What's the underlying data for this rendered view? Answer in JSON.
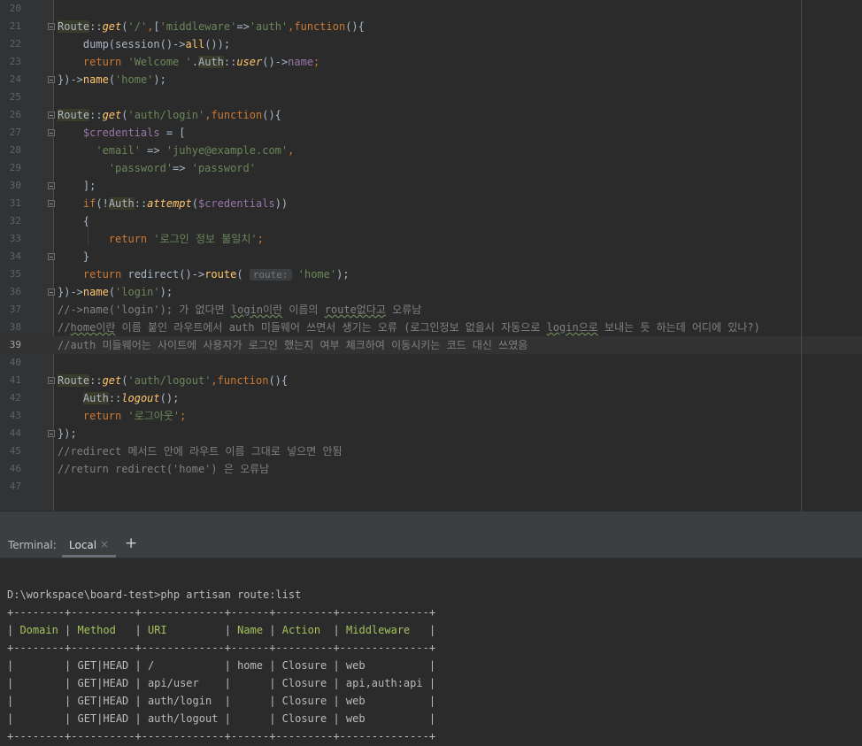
{
  "editor": {
    "current_line": "39",
    "lines": [
      {
        "num": "20",
        "parts": []
      },
      {
        "num": "21",
        "fold": true,
        "parts": [
          [
            "cls",
            "Route"
          ],
          [
            "p",
            "::"
          ],
          [
            "fn it",
            "get"
          ],
          [
            "p",
            "("
          ],
          [
            "str",
            "'/'"
          ],
          [
            "kw",
            ","
          ],
          [
            "p",
            "["
          ],
          [
            "str",
            "'middleware'"
          ],
          [
            "p",
            "=>"
          ],
          [
            "str",
            "'auth'"
          ],
          [
            "kw",
            ","
          ],
          [
            "kw",
            "function"
          ],
          [
            "p",
            "(){"
          ]
        ]
      },
      {
        "num": "22",
        "parts": [
          [
            "p",
            "    dump(session()->"
          ],
          [
            "fn",
            "all"
          ],
          [
            "p",
            "());"
          ]
        ]
      },
      {
        "num": "23",
        "parts": [
          [
            "p",
            "    "
          ],
          [
            "kw",
            "return "
          ],
          [
            "str",
            "'Welcome '"
          ],
          [
            "p",
            "."
          ],
          [
            "cls",
            "Auth"
          ],
          [
            "p",
            "::"
          ],
          [
            "fn it",
            "user"
          ],
          [
            "p",
            "()->"
          ],
          [
            "var",
            "name"
          ],
          [
            "kw",
            ";"
          ]
        ]
      },
      {
        "num": "24",
        "fold": true,
        "parts": [
          [
            "p",
            "})->"
          ],
          [
            "fn",
            "name"
          ],
          [
            "p",
            "("
          ],
          [
            "str",
            "'home'"
          ],
          [
            "p",
            ");"
          ]
        ]
      },
      {
        "num": "25",
        "parts": []
      },
      {
        "num": "26",
        "fold": true,
        "parts": [
          [
            "cls",
            "Route"
          ],
          [
            "p",
            "::"
          ],
          [
            "fn it",
            "get"
          ],
          [
            "p",
            "("
          ],
          [
            "str",
            "'auth/login'"
          ],
          [
            "kw",
            ","
          ],
          [
            "kw",
            "function"
          ],
          [
            "p",
            "(){"
          ]
        ]
      },
      {
        "num": "27",
        "fold": true,
        "parts": [
          [
            "p",
            "    "
          ],
          [
            "var",
            "$credentials"
          ],
          [
            "p",
            " = ["
          ]
        ]
      },
      {
        "num": "28",
        "parts": [
          [
            "p",
            "      "
          ],
          [
            "str",
            "'email'"
          ],
          [
            "p",
            " => "
          ],
          [
            "str",
            "'juhye@example.com'"
          ],
          [
            "kw",
            ","
          ]
        ]
      },
      {
        "num": "29",
        "parts": [
          [
            "p",
            "        "
          ],
          [
            "str",
            "'password'"
          ],
          [
            "p",
            "=> "
          ],
          [
            "str",
            "'password'"
          ]
        ]
      },
      {
        "num": "30",
        "fold": true,
        "parts": [
          [
            "p",
            "    ];"
          ]
        ]
      },
      {
        "num": "31",
        "fold": true,
        "parts": [
          [
            "p",
            "    "
          ],
          [
            "kw",
            "if"
          ],
          [
            "p",
            "(!"
          ],
          [
            "cls",
            "Auth"
          ],
          [
            "p",
            "::"
          ],
          [
            "fn it",
            "attempt"
          ],
          [
            "p",
            "("
          ],
          [
            "var",
            "$credentials"
          ],
          [
            "p",
            "))"
          ]
        ]
      },
      {
        "num": "32",
        "parts": [
          [
            "p",
            "    {"
          ]
        ]
      },
      {
        "num": "33",
        "parts": [
          [
            "p",
            "        "
          ],
          [
            "kw",
            "return "
          ],
          [
            "str",
            "'로그인 정보 불일치'"
          ],
          [
            "kw",
            ";"
          ]
        ]
      },
      {
        "num": "34",
        "fold": true,
        "parts": [
          [
            "p",
            "    }"
          ]
        ]
      },
      {
        "num": "35",
        "parts": [
          [
            "p",
            "    "
          ],
          [
            "kw",
            "return "
          ],
          [
            "p",
            "redirect()->"
          ],
          [
            "fn",
            "route"
          ],
          [
            "p",
            "( "
          ],
          [
            "hint",
            "route:"
          ],
          [
            "p",
            " "
          ],
          [
            "str",
            "'home'"
          ],
          [
            "p",
            ");"
          ]
        ]
      },
      {
        "num": "36",
        "fold": true,
        "parts": [
          [
            "p",
            "})->"
          ],
          [
            "fn",
            "name"
          ],
          [
            "p",
            "("
          ],
          [
            "str",
            "'login'"
          ],
          [
            "p",
            ");"
          ]
        ]
      },
      {
        "num": "37",
        "parts": [
          [
            "cm",
            "//->name('login'); 가 없다면 "
          ],
          [
            "cm sq",
            "login이란"
          ],
          [
            "cm",
            " 이름의 "
          ],
          [
            "cm sq",
            "route없다고"
          ],
          [
            "cm",
            " 오류남"
          ]
        ]
      },
      {
        "num": "38",
        "parts": [
          [
            "cm",
            "//"
          ],
          [
            "cm sq",
            "home이란"
          ],
          [
            "cm",
            " 이름 붙인 라우트에서 auth 미들웨어 쓰면서 생기는 오류 (로그인정보 없을시 자동으로 "
          ],
          [
            "cm sq",
            "login으로"
          ],
          [
            "cm",
            " 보내는 듯 하는데 어디에 있나?)"
          ]
        ]
      },
      {
        "num": "39",
        "parts": [
          [
            "cm",
            "//auth 미들웨어는 사이트에 사용자가 로그인 했는지 여부 체크하여 이동시키는 코드 대신 쓰였음"
          ]
        ]
      },
      {
        "num": "40",
        "parts": []
      },
      {
        "num": "41",
        "fold": true,
        "parts": [
          [
            "cls",
            "Route"
          ],
          [
            "p",
            "::"
          ],
          [
            "fn it",
            "get"
          ],
          [
            "p",
            "("
          ],
          [
            "str",
            "'auth/logout'"
          ],
          [
            "kw",
            ","
          ],
          [
            "kw",
            "function"
          ],
          [
            "p",
            "(){"
          ]
        ]
      },
      {
        "num": "42",
        "parts": [
          [
            "p",
            "    "
          ],
          [
            "cls",
            "Auth"
          ],
          [
            "p",
            "::"
          ],
          [
            "fn it",
            "logout"
          ],
          [
            "p",
            "();"
          ]
        ]
      },
      {
        "num": "43",
        "parts": [
          [
            "p",
            "    "
          ],
          [
            "kw",
            "return "
          ],
          [
            "str",
            "'로그아웃'"
          ],
          [
            "kw",
            ";"
          ]
        ]
      },
      {
        "num": "44",
        "fold": true,
        "parts": [
          [
            "p",
            "});"
          ]
        ]
      },
      {
        "num": "45",
        "parts": [
          [
            "cm",
            "//redirect 메서드 안에 라우트 이름 그대로 넣으면 안됨"
          ]
        ]
      },
      {
        "num": "46",
        "parts": [
          [
            "cm",
            "//return redirect('home') 은 오류남"
          ]
        ]
      },
      {
        "num": "47",
        "parts": []
      }
    ]
  },
  "terminal": {
    "title": "Terminal:",
    "tab_label": "Local",
    "tab_close": "×",
    "new_tab": "+",
    "lines": [
      {
        "text": ""
      },
      {
        "text": "D:\\workspace\\board-test>php artisan route:list"
      },
      {
        "text": "+--------+----------+-------------+------+---------+--------------+"
      },
      {
        "parts": [
          [
            "p",
            "| "
          ],
          [
            "th",
            "Domain"
          ],
          [
            "p",
            " | "
          ],
          [
            "th",
            "Method"
          ],
          [
            "p",
            "   | "
          ],
          [
            "th",
            "URI"
          ],
          [
            "p",
            "         | "
          ],
          [
            "th",
            "Name"
          ],
          [
            "p",
            " | "
          ],
          [
            "th",
            "Action"
          ],
          [
            "p",
            "  | "
          ],
          [
            "th",
            "Middleware"
          ],
          [
            "p",
            "   |"
          ]
        ]
      },
      {
        "text": "+--------+----------+-------------+------+---------+--------------+"
      },
      {
        "text": "|        | GET|HEAD | /           | home | Closure | web          |"
      },
      {
        "text": "|        | GET|HEAD | api/user    |      | Closure | api,auth:api |"
      },
      {
        "text": "|        | GET|HEAD | auth/login  |      | Closure | web          |"
      },
      {
        "text": "|        | GET|HEAD | auth/logout |      | Closure | web          |"
      },
      {
        "text": "+--------+----------+-------------+------+---------+--------------+"
      }
    ]
  }
}
